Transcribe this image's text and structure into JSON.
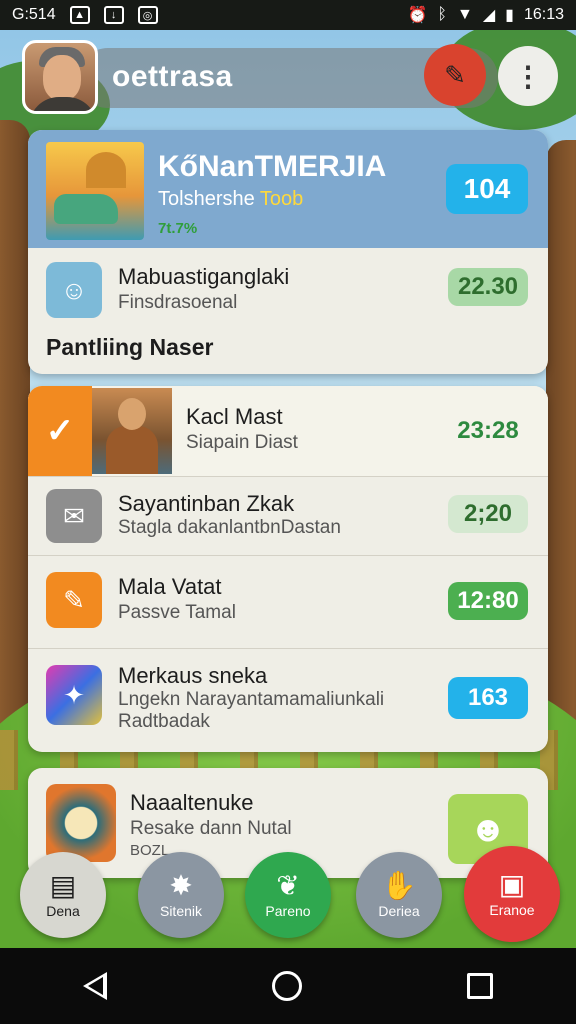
{
  "status_bar": {
    "time_left": "G:514",
    "time_right": "16:13",
    "icons": [
      "gallery-icon",
      "download-icon",
      "camera-icon",
      "alarm-icon",
      "bluetooth-icon",
      "wifi-icon",
      "signal-icon",
      "battery-icon"
    ]
  },
  "app_bar": {
    "title": "oettrasa",
    "action_icon": "map-pin-icon",
    "menu_icon": "more-vert-icon"
  },
  "featured": {
    "title": "KőNanTMERJIA",
    "subtitle_part1": "Tolshershe",
    "subtitle_part2": "Toob",
    "percent": "7t.7%",
    "badge": "104",
    "badge_color": "#23b2ea"
  },
  "list1": {
    "items": [
      {
        "title": "Mabuastiganglaki",
        "subtitle": "Finsdrasoenal",
        "badge": "22.30",
        "icon": "alien-face-icon",
        "badge_color": "#a8d8a6"
      }
    ],
    "section_label": "Pantliing Naser"
  },
  "list2": {
    "items": [
      {
        "title": "Kacl Mast",
        "subtitle": "Siapain Diast",
        "badge": "23:28",
        "icon": "photo-icon",
        "selected": true
      },
      {
        "title": "Sayantinban Zkak",
        "subtitle": "Stagla dakanlantbnDastan",
        "badge": "2;20",
        "icon": "chat-bubble-icon",
        "badge_color": "#d4e8d0"
      },
      {
        "title": "Mala Vatat",
        "subtitle": "Passve Tamal",
        "badge": "12:80",
        "icon": "pencil-icon",
        "badge_color": "#4caf50"
      },
      {
        "title": "Merkaus sneka",
        "subtitle": "Lngekn Narayantamamaliunkali",
        "subtitle2": "Radtbadak",
        "badge": "163",
        "icon": "palette-icon",
        "badge_color": "#23b2ea"
      }
    ]
  },
  "list3": {
    "items": [
      {
        "title": "Naaaltenuke",
        "subtitle": "Resake dann Nutal",
        "subtitle2": "BOZL",
        "icon": "dial-icon"
      }
    ]
  },
  "dock": {
    "buttons": [
      {
        "label": "Dena",
        "icon": "document-icon",
        "color": "#d7d7d0"
      },
      {
        "label": "Sitenik",
        "icon": "badge-icon",
        "color": "#8b96a2"
      },
      {
        "label": "Pareno",
        "icon": "leaf-icon",
        "color": "#2fa84f"
      },
      {
        "label": "Deriea",
        "icon": "hands-icon",
        "color": "#8b96a2"
      },
      {
        "label": "Eranoe",
        "icon": "briefcase-icon",
        "color": "#e23b3b"
      }
    ]
  }
}
